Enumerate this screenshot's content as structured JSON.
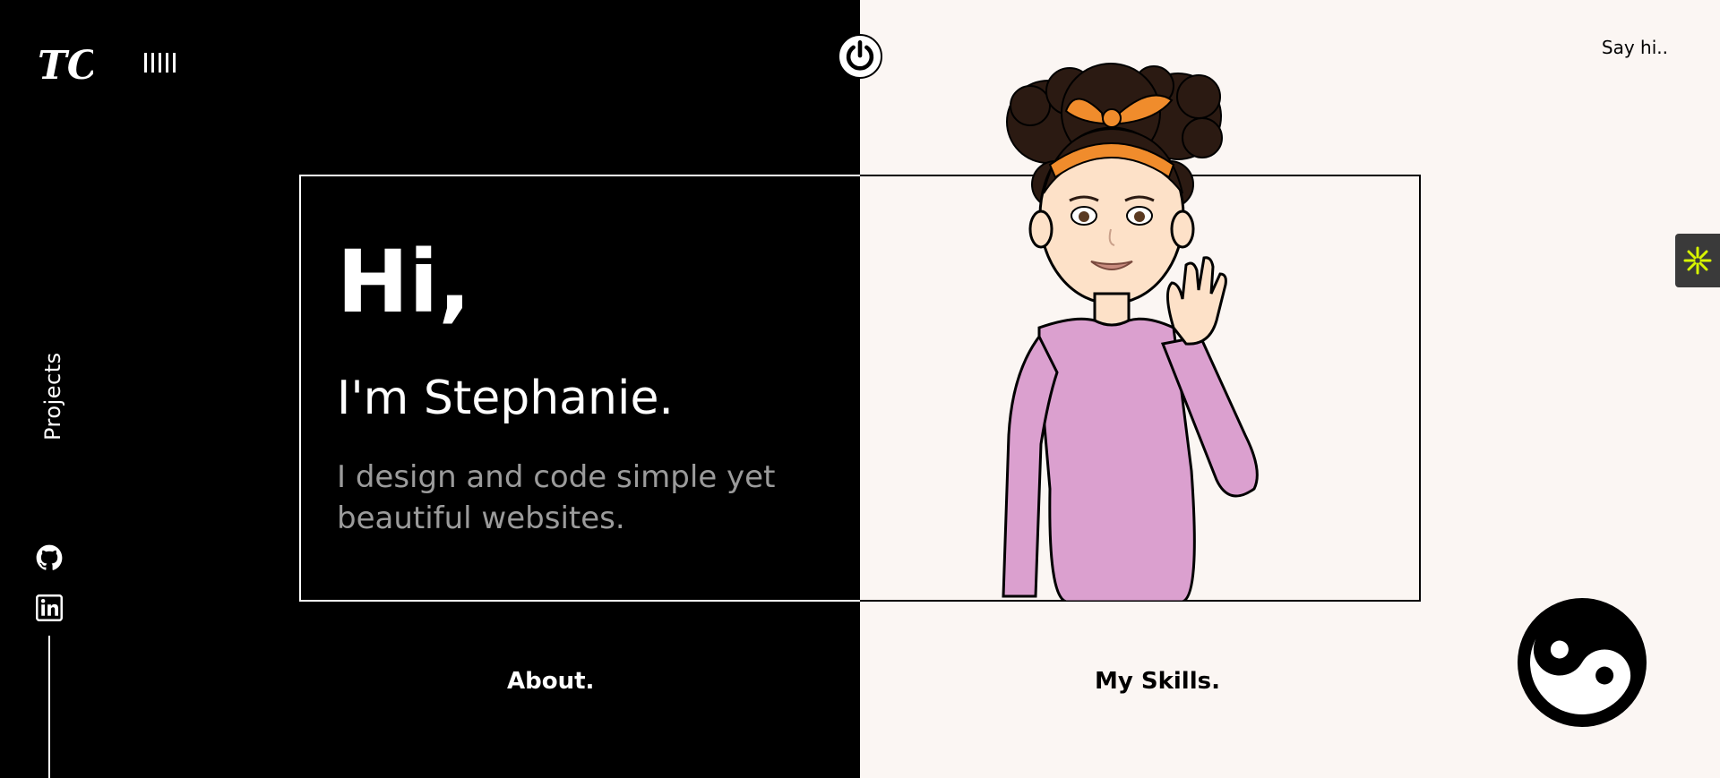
{
  "brand": {
    "logo_text": "TC"
  },
  "nav": {
    "say_hi": "Say hi..",
    "projects": "Projects",
    "about": "About.",
    "skills": "My Skills."
  },
  "hero": {
    "greeting": "Hi,",
    "name_line": "I'm Stephanie.",
    "tagline": "I design and code simple yet beautiful websites."
  },
  "icons": {
    "menu": "menu-bars-icon",
    "power": "power-icon",
    "github": "github-icon",
    "linkedin": "linkedin-icon",
    "widget": "asterisk-icon",
    "theme": "yin-yang-icon"
  },
  "colors": {
    "dark": "#000000",
    "light": "#fbf6f3",
    "accent": "#d7f500",
    "muted_text": "#9b9b9b",
    "shirt": "#dba0cf",
    "headband": "#f08c2c"
  }
}
